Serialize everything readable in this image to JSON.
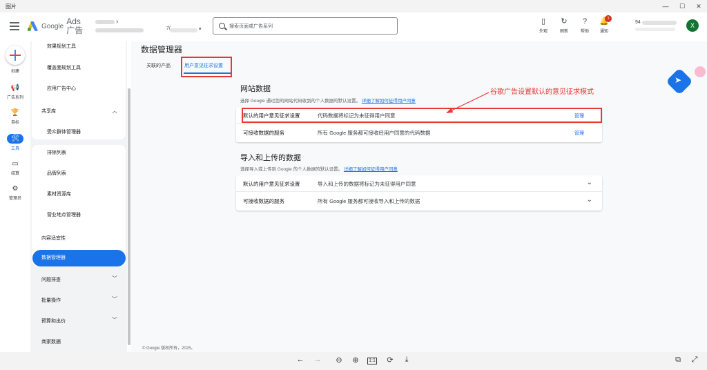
{
  "window": {
    "title": "图片",
    "controls": [
      "—",
      "☐",
      "✕"
    ]
  },
  "header": {
    "logo_google": "Google",
    "logo_ads": "Ads",
    "logo_cn": "广告",
    "account_number_prefix": "7(",
    "search_placeholder": "搜索页面或广告系列",
    "buttons": [
      {
        "label": "外观",
        "icon": "▯"
      },
      {
        "label": "刷新",
        "icon": "↻"
      },
      {
        "label": "帮助",
        "icon": "?"
      },
      {
        "label": "通知",
        "icon": "🔔",
        "badge": "1"
      }
    ],
    "user_id_prefix": "94",
    "avatar_letter": "X"
  },
  "rail": {
    "create_label": "创建",
    "items": [
      {
        "label": "广告系列",
        "icon": "📢"
      },
      {
        "label": "目标",
        "icon": "🏆"
      },
      {
        "label": "工具",
        "icon": "🛠"
      },
      {
        "label": "结算",
        "icon": "▭"
      },
      {
        "label": "管理员",
        "icon": "⚙"
      }
    ]
  },
  "nav": {
    "tools_items": [
      "效果规划工具",
      "覆盖面规划工具",
      "应用广告中心"
    ],
    "shared_library": "共享库",
    "shared_items": [
      "受众群体管理器",
      "排除列表",
      "品牌列表",
      "素材资源库",
      "营业地点管理器"
    ],
    "content_suitability": "内容适宜性",
    "data_manager": "数据管理器",
    "collapsible": [
      "问题排查",
      "批量操作",
      "预算和出价",
      "商家数据"
    ]
  },
  "main": {
    "title": "数据管理器",
    "tabs": [
      "关联的产品",
      "用户意见征求设置"
    ],
    "website_section": {
      "title": "网站数据",
      "desc": "选择 Google 通过您的网站代码收到的个人数据的默认设置。",
      "link": "详细了解如何征得用户同意",
      "rows": [
        {
          "key": "默认的用户意见征求设置",
          "value": "代码数据将标记为未征得用户同意",
          "action": "管理"
        },
        {
          "key": "可接收数据的服务",
          "value": "所有 Google 服务都可接收经用户同意的代码数据",
          "action": "管理"
        }
      ]
    },
    "upload_section": {
      "title": "导入和上传的数据",
      "desc": "选择导入或上传到 Google 的个人数据的默认设置。",
      "link": "详细了解如何征得用户同意",
      "rows": [
        {
          "key": "默认的用户意见征求设置",
          "value": "导入和上传的数据将标记为未征得用户同意"
        },
        {
          "key": "可接收数据的服务",
          "value": "所有 Google 服务都可接收导入和上传的数据"
        }
      ]
    },
    "annotation": "谷歌广告设置默认的意见征求模式",
    "footer": "© Google 版权所有，2025。"
  },
  "viewer_toolbar": [
    "←",
    "→",
    "⊖",
    "⊕",
    "1:1",
    "⟳",
    "⤓",
    "⧉"
  ],
  "colors": {
    "accent": "#1a73e8",
    "annotation": "#e53935",
    "avatar": "#137333"
  }
}
